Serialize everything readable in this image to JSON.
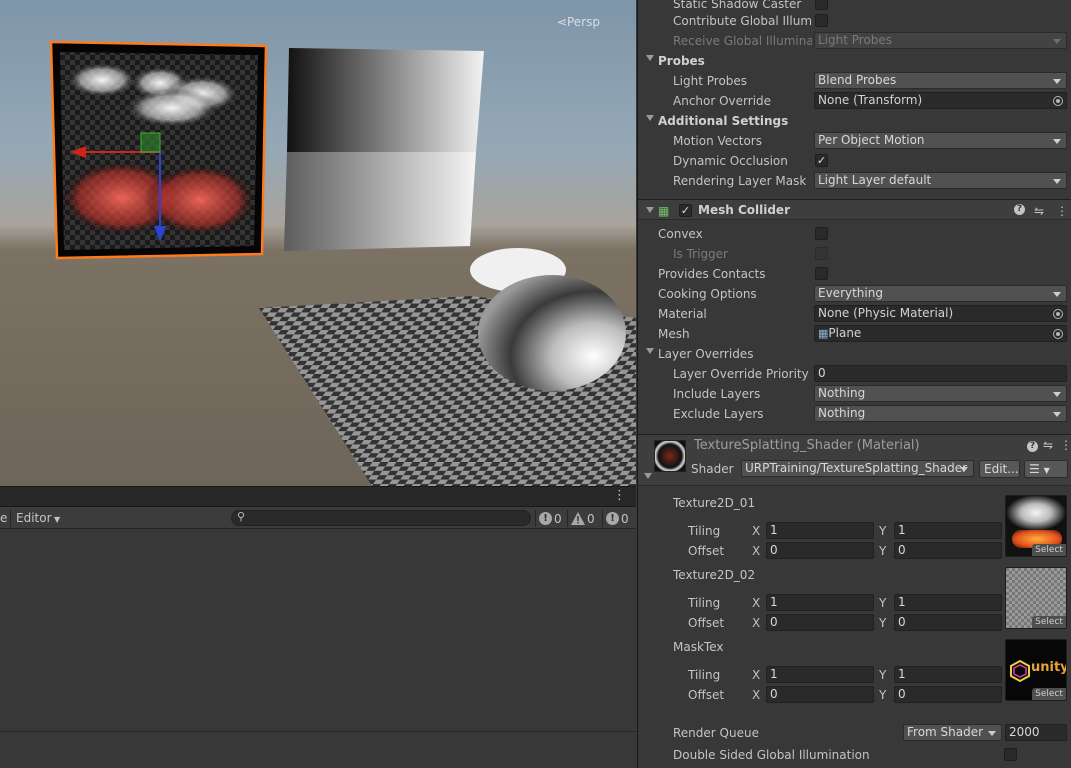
{
  "scene": {
    "camera_label": "Persp"
  },
  "console": {
    "editor_label": "Editor",
    "clip_label": "e",
    "search_placeholder": "",
    "log_count": "0",
    "warning_count": "0",
    "error_count": "0"
  },
  "inspector": {
    "mesh_renderer": {
      "static_shadow_caster": "Static Shadow Caster",
      "contribute_gi": "Contribute Global Illumination",
      "receive_gi": {
        "label": "Receive Global Illumination",
        "value": "Light Probes"
      },
      "probes_header": "Probes",
      "light_probes": {
        "label": "Light Probes",
        "value": "Blend Probes"
      },
      "anchor_override": {
        "label": "Anchor Override",
        "value": "None (Transform)"
      },
      "additional_header": "Additional Settings",
      "motion_vectors": {
        "label": "Motion Vectors",
        "value": "Per Object Motion"
      },
      "dynamic_occlusion": {
        "label": "Dynamic Occlusion",
        "checked": true
      },
      "rendering_layer_mask": {
        "label": "Rendering Layer Mask",
        "value": "Light Layer default"
      }
    },
    "mesh_collider": {
      "title": "Mesh Collider",
      "convex": "Convex",
      "is_trigger": "Is Trigger",
      "provides_contacts": "Provides Contacts",
      "cooking_options": {
        "label": "Cooking Options",
        "value": "Everything"
      },
      "material": {
        "label": "Material",
        "value": "None (Physic Material)"
      },
      "mesh": {
        "label": "Mesh",
        "value": "Plane"
      },
      "layer_overrides_header": "Layer Overrides",
      "layer_override_priority": {
        "label": "Layer Override Priority",
        "value": "0"
      },
      "include_layers": {
        "label": "Include Layers",
        "value": "Nothing"
      },
      "exclude_layers": {
        "label": "Exclude Layers",
        "value": "Nothing"
      }
    },
    "material": {
      "title": "TextureSplatting_Shader (Material)",
      "shader_label": "Shader",
      "shader_value": "URPTraining/TextureSplatting_Shader",
      "edit_button": "Edit...",
      "textures": [
        {
          "name": "Texture2D_01",
          "tiling_x": "1",
          "tiling_y": "1",
          "offset_x": "0",
          "offset_y": "0"
        },
        {
          "name": "Texture2D_02",
          "tiling_x": "1",
          "tiling_y": "1",
          "offset_x": "0",
          "offset_y": "0"
        },
        {
          "name": "MaskTex",
          "tiling_x": "1",
          "tiling_y": "1",
          "offset_x": "0",
          "offset_y": "0"
        }
      ],
      "tiling_label": "Tiling",
      "offset_label": "Offset",
      "x_label": "X",
      "y_label": "Y",
      "select_label": "Select",
      "mask_logo_text": "unity",
      "render_queue": {
        "label": "Render Queue",
        "mode": "From Shader",
        "value": "2000"
      },
      "double_sided_gi": "Double Sided Global Illumination"
    }
  }
}
